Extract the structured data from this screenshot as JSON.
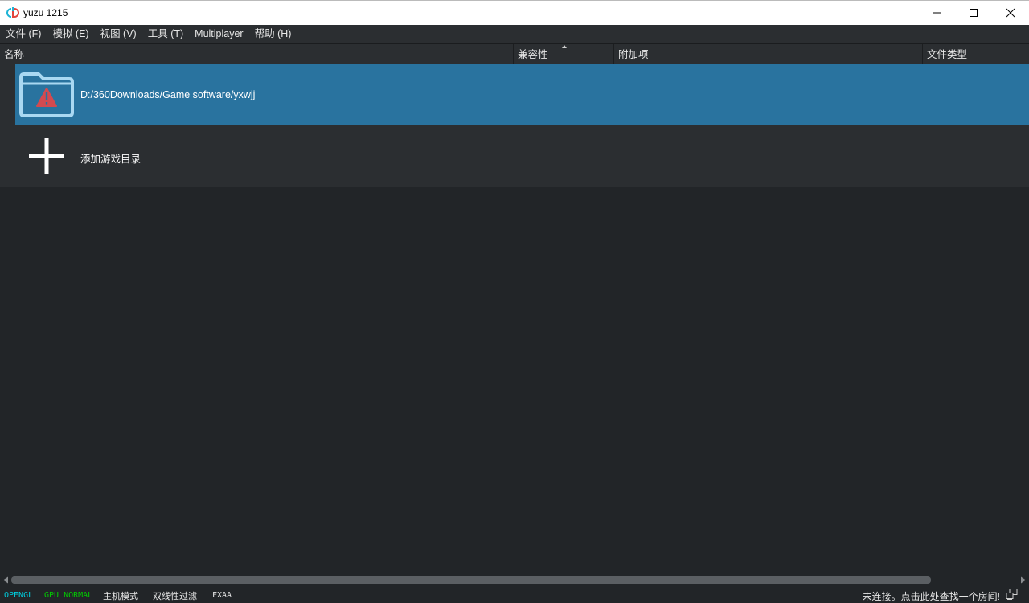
{
  "window": {
    "title": "yuzu 1215"
  },
  "menu": {
    "items": [
      "文件 (F)",
      "模拟 (E)",
      "视图 (V)",
      "工具 (T)",
      "Multiplayer",
      "帮助 (H)"
    ]
  },
  "columns": {
    "name": "名称",
    "compatibility": "兼容性",
    "addons": "附加项",
    "file_type": "文件类型"
  },
  "list": {
    "game_dir_path": "D:/360Downloads/Game software/yxwjj",
    "add_dir_label": "添加游戏目录"
  },
  "status": {
    "api": "OPENGL",
    "gpu": "GPU NORMAL",
    "mode": "主机模式",
    "filter": "双线性过滤",
    "aa": "FXAA",
    "network": "未连接。点击此处查找一个房间!"
  },
  "colors": {
    "api": "#00ccdd",
    "gpu": "#00cc00",
    "selection": "#29739f",
    "background": "#222528"
  },
  "icons": {
    "app": "yuzu-logo-icon",
    "folder": "folder-warning-icon",
    "add": "plus-icon",
    "network": "network-status-icon"
  }
}
